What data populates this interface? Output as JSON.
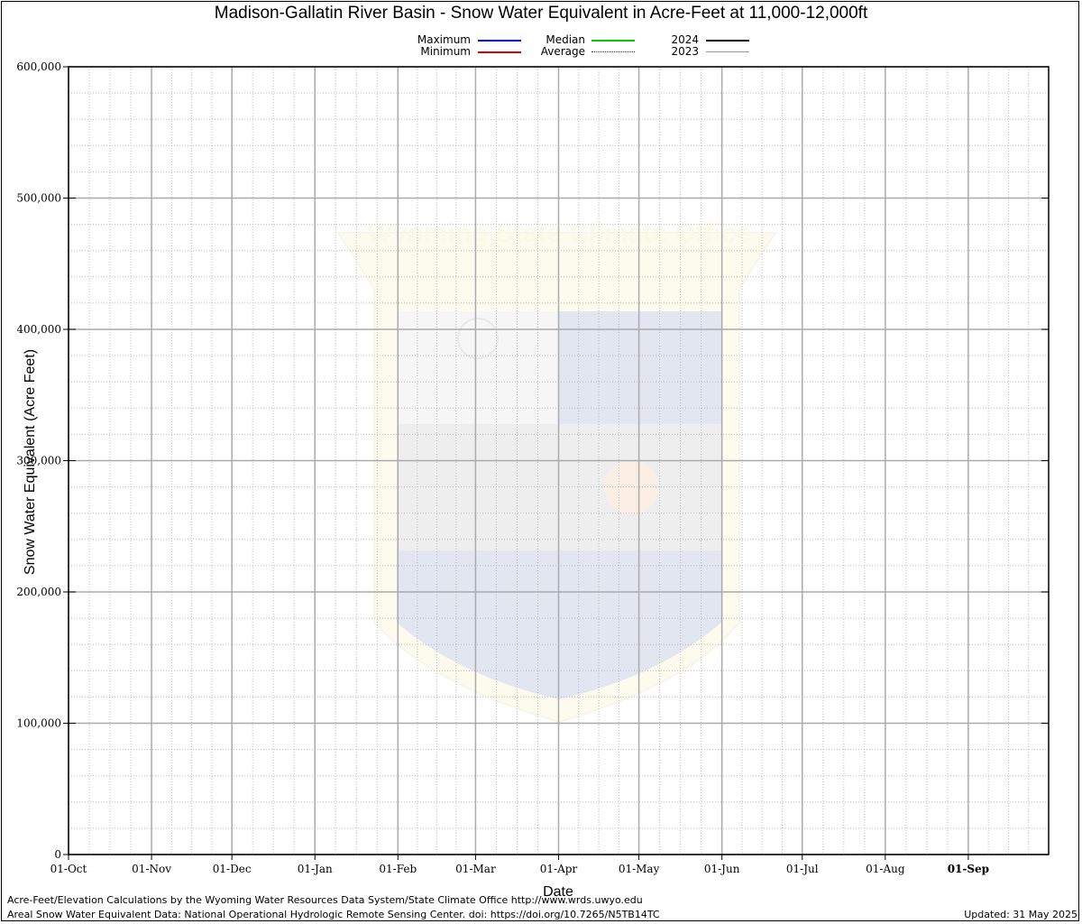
{
  "chart_data": {
    "type": "line",
    "title": "Madison-Gallatin River Basin - Snow Water Equivalent in Acre-Feet at 11,000-12,000ft",
    "xlabel": "Date",
    "ylabel": "Snow Water Equivalent (Acre Feet)",
    "ylim": [
      0,
      600000
    ],
    "y_ticks": [
      "0",
      "100,000",
      "200,000",
      "300,000",
      "400,000",
      "500,000",
      "600,000"
    ],
    "x_ticks": [
      "01-Oct",
      "01-Nov",
      "01-Dec",
      "01-Jan",
      "01-Feb",
      "01-Mar",
      "01-Apr",
      "01-May",
      "01-Jun",
      "01-Jul",
      "01-Aug",
      "01-Sep"
    ],
    "grid": true,
    "legend_placement": "top-center",
    "series": [
      {
        "name": "Maximum",
        "color": "#0000cc",
        "style": "solid",
        "values": []
      },
      {
        "name": "Minimum",
        "color": "#dd0000",
        "style": "solid",
        "values": []
      },
      {
        "name": "Median",
        "color": "#00cc00",
        "style": "solid",
        "values": []
      },
      {
        "name": "Average",
        "color": "#333333",
        "style": "dotted",
        "values": []
      },
      {
        "name": "2024",
        "color": "#000000",
        "style": "solid",
        "values": []
      },
      {
        "name": "2023",
        "color": "#999999",
        "style": "solid",
        "values": []
      }
    ]
  },
  "watermark": {
    "text": "Wyoming State Climate Office"
  },
  "footer": {
    "credit_1": "Acre-Feet/Elevation Calculations by the Wyoming Water Resources Data System/State Climate Office http://www.wrds.uwyo.edu",
    "credit_2": "Areal Snow Water Equivalent Data: National Operational Hydrologic Remote Sensing Center. doi: https://doi.org/10.7265/N5TB14TC",
    "updated": "Updated: 31 May 2025"
  }
}
